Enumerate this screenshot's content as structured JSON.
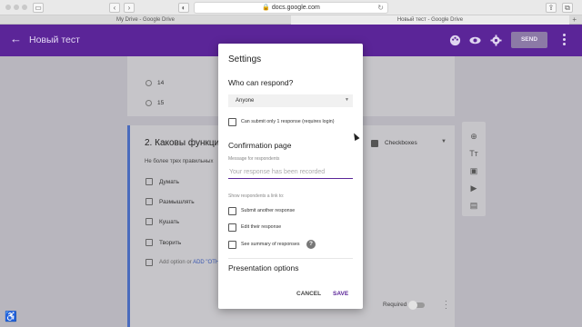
{
  "browser": {
    "url": "docs.google.com",
    "tabs": [
      {
        "label": "My Drive - Google Drive",
        "active": false
      },
      {
        "label": "Новый тест - Google Drive",
        "active": true
      }
    ]
  },
  "appbar": {
    "title": "Новый тест",
    "send_label": "SEND"
  },
  "form": {
    "prev_options": [
      "14",
      "15"
    ],
    "question_title": "2. Каковы функци",
    "question_sub": "Не более трех правильных",
    "options": [
      "Думать",
      "Размышлять",
      "Кушать",
      "Творить"
    ],
    "add_option": "Add option",
    "add_other_connector": "or",
    "add_other": "ADD \"OTH",
    "question_type": "Checkboxes",
    "required_label": "Required"
  },
  "dialog": {
    "title": "Settings",
    "who_can_respond": "Who can respond?",
    "audience_value": "Anyone",
    "one_response_label": "Can submit only 1 response (requires login)",
    "confirmation_title": "Confirmation page",
    "message_label": "Message for respondents",
    "message_placeholder": "Your response has been recorded",
    "show_link_label": "Show respondents a link to:",
    "link_options": [
      "Submit another response",
      "Edit their response",
      "See summary of responses"
    ],
    "help_glyph": "?",
    "presentation_title": "Presentation options",
    "cancel_label": "CANCEL",
    "save_label": "SAVE"
  },
  "colors": {
    "brand": "#5b2598",
    "link": "#3a58b0"
  }
}
